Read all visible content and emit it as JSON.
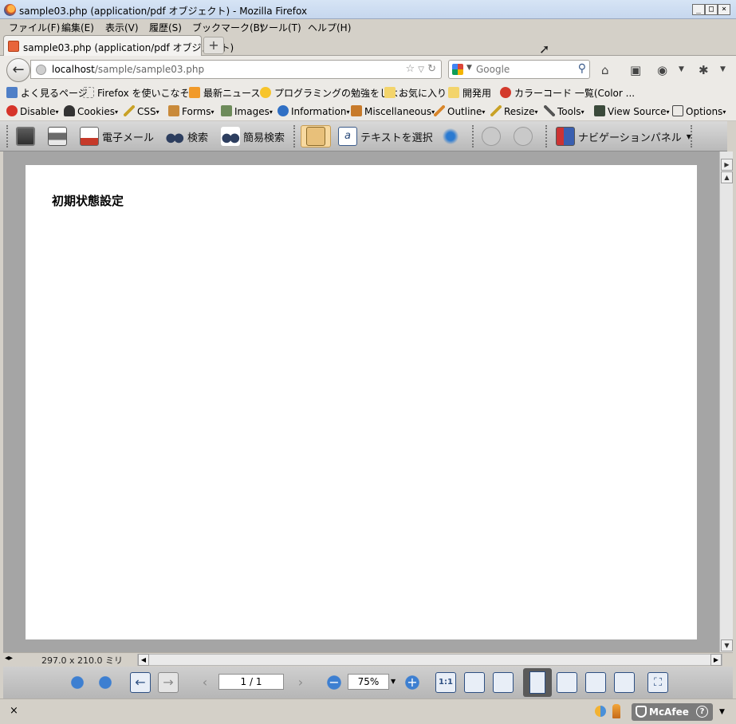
{
  "window": {
    "title": "sample03.php (application/pdf オブジェクト) - Mozilla Firefox"
  },
  "menubar": [
    "ファイル(F)",
    "編集(E)",
    "表示(V)",
    "履歴(S)",
    "ブックマーク(B)",
    "ツール(T)",
    "ヘルプ(H)"
  ],
  "tabs": [
    {
      "label": "sample03.php (application/pdf オブジェクト)"
    }
  ],
  "navbar": {
    "url_host": "localhost",
    "url_path": "/sample/sample03.php",
    "search_placeholder": "Google"
  },
  "bookmarks": [
    "よく見るページ",
    "Firefox を使いこなそう",
    "最新ニュース",
    "プログラミングの勉強をしよ...",
    "お気に入り",
    "開発用",
    "カラーコード 一覧(Color ..."
  ],
  "devtools": [
    "Disable",
    "Cookies",
    "CSS",
    "Forms",
    "Images",
    "Information",
    "Miscellaneous",
    "Outline",
    "Resize",
    "Tools",
    "View Source",
    "Options"
  ],
  "pdf_toolbar": {
    "email_label": "電子メール",
    "search_label": "検索",
    "quick_search_label": "簡易検索",
    "select_text_label": "テキストを選択",
    "nav_panel_label": "ナビゲーションパネル"
  },
  "document": {
    "heading": "初期状態設定"
  },
  "info": {
    "page_size": "297.0 x 210.0 ミリ"
  },
  "pdf_nav": {
    "page": "1 / 1",
    "zoom": "75%"
  },
  "status": {
    "mcafee_label": "McAfee"
  }
}
